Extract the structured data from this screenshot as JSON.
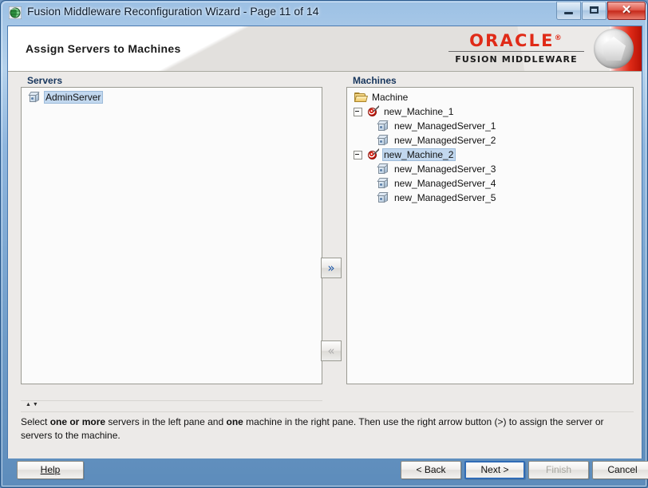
{
  "window": {
    "title": "Fusion Middleware Reconfiguration Wizard - Page 11 of 14",
    "icon": "app-globe-icon",
    "controls": {
      "minimize": "minimize-icon",
      "maximize": "maximize-icon",
      "close": "✕"
    }
  },
  "banner": {
    "title": "Assign Servers to Machines",
    "logo": {
      "brand": "ORACLE",
      "trademark": "®",
      "product": "FUSION MIDDLEWARE"
    }
  },
  "servers_pane": {
    "header": "Servers",
    "items": [
      {
        "label": "AdminServer",
        "icon": "server-cube-icon",
        "selected": true
      }
    ]
  },
  "machines_pane": {
    "header": "Machines",
    "root": {
      "label": "Machine",
      "icon": "folder-icon"
    },
    "machines": [
      {
        "label": "new_Machine_1",
        "icon": "machine-target-icon",
        "expanded": true,
        "selected": false,
        "servers": [
          {
            "label": "new_ManagedServer_1",
            "icon": "server-cube-icon"
          },
          {
            "label": "new_ManagedServer_2",
            "icon": "server-cube-icon"
          }
        ]
      },
      {
        "label": "new_Machine_2",
        "icon": "machine-target-icon",
        "expanded": true,
        "selected": true,
        "servers": [
          {
            "label": "new_ManagedServer_3",
            "icon": "server-cube-icon"
          },
          {
            "label": "new_ManagedServer_4",
            "icon": "server-cube-icon"
          },
          {
            "label": "new_ManagedServer_5",
            "icon": "server-cube-icon"
          }
        ]
      }
    ]
  },
  "transfer": {
    "assign_label": "»",
    "unassign_label": "«",
    "unassign_enabled": false
  },
  "instruction": {
    "part1": "Select ",
    "bold1": "one or more",
    "part2": " servers in the left pane and ",
    "bold2": "one",
    "part3": " machine in the right pane. Then use the right arrow button (>) to assign the server or servers to the machine."
  },
  "buttons": {
    "help": "Help",
    "help_mnemonic": "H",
    "back": "< Back",
    "back_mnemonic": "B",
    "next": "Next >",
    "next_mnemonic": "N",
    "finish": "Finish",
    "finish_mnemonic": "F",
    "cancel": "Cancel",
    "finish_enabled": false,
    "next_focused": true
  },
  "colors": {
    "accent": "#2f6bb5",
    "oracle_red": "#e02b18",
    "selection": "#c2d8ef",
    "pane_header_text": "#16355c"
  }
}
